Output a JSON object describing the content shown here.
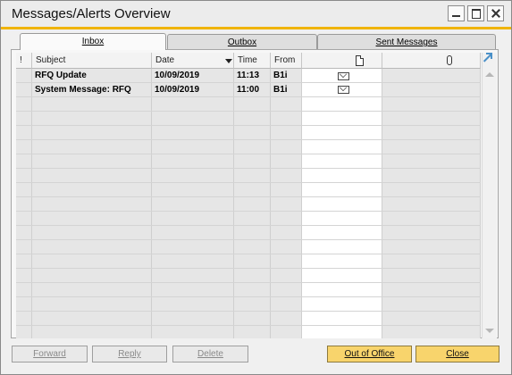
{
  "window": {
    "title": "Messages/Alerts Overview"
  },
  "tabs": [
    {
      "label": "Inbox",
      "active": true
    },
    {
      "label": "Outbox",
      "active": false
    },
    {
      "label": "Sent Messages",
      "active": false
    }
  ],
  "table": {
    "columns": [
      "!",
      "Subject",
      "Date",
      "Time",
      "From"
    ],
    "icon_columns": [
      "document-icon",
      "attachment-icon"
    ],
    "rows": [
      {
        "subject": "RFQ Update",
        "date": "10/09/2019",
        "time": "11:13",
        "from": "B1i",
        "icon": "envelope-icon"
      },
      {
        "subject": "System Message: RFQ",
        "date": "10/09/2019",
        "time": "11:00",
        "from": "B1i",
        "icon": "envelope-icon"
      }
    ]
  },
  "buttons": {
    "forward": "Forward",
    "reply": "Reply",
    "delete": "Delete",
    "out_of_office": "Out of Office",
    "close": "Close"
  },
  "colors": {
    "accent": "#f0b400",
    "primary_button": "#f8d46c"
  }
}
